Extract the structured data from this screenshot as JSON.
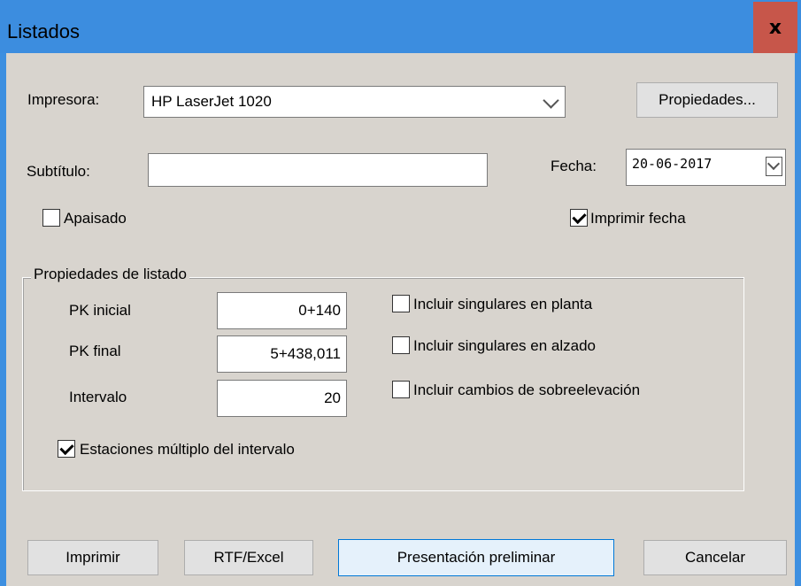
{
  "window": {
    "title": "Listados",
    "close_label": "x"
  },
  "printer": {
    "label": "Impresora:",
    "value": "HP LaserJet 1020",
    "properties_button": "Propiedades..."
  },
  "subtitle": {
    "label": "Subtítulo:",
    "value": ""
  },
  "date": {
    "label": "Fecha:",
    "value": "20-06-2017"
  },
  "landscape": {
    "label": "Apaisado",
    "checked": false
  },
  "print_date": {
    "label": "Imprimir fecha",
    "checked": true
  },
  "group": {
    "title": "Propiedades de listado",
    "pk_start": {
      "label": "PK inicial",
      "value": "0+140"
    },
    "pk_end": {
      "label": "PK final",
      "value": "5+438,011"
    },
    "interval": {
      "label": "Intervalo",
      "value": "20"
    },
    "singular_plan": {
      "label": "Incluir singulares en planta",
      "checked": false
    },
    "singular_elevation": {
      "label": "Incluir singulares en alzado",
      "checked": false
    },
    "superelevation": {
      "label": "Incluir cambios de sobreelevación",
      "checked": false
    },
    "stations_multiple": {
      "label": "Estaciones múltiplo del intervalo",
      "checked": true
    }
  },
  "buttons": {
    "print": "Imprimir",
    "rtf_excel": "RTF/Excel",
    "preview": "Presentación preliminar",
    "cancel": "Cancelar"
  }
}
